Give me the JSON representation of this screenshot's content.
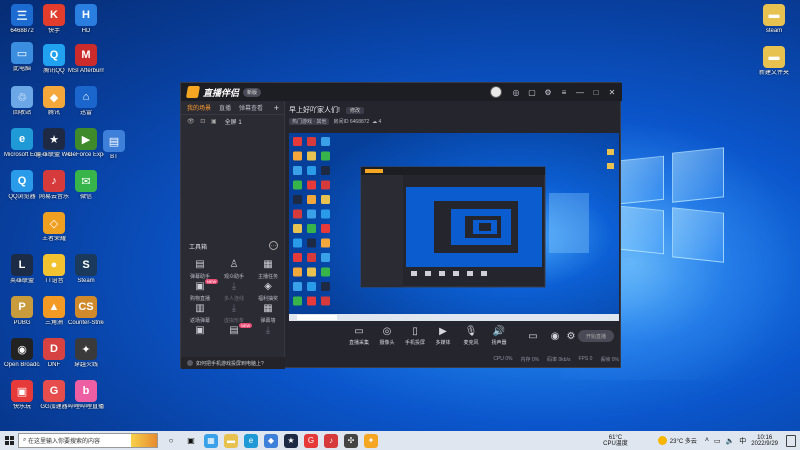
{
  "desktop_icons": [
    {
      "label": "6468872",
      "color": "#1c6bd0",
      "glyph": "三",
      "icon": "monitor-icon"
    },
    {
      "label": "此电脑",
      "color": "#3b8de0",
      "glyph": "▭",
      "icon": "computer-icon"
    },
    {
      "label": "回收站",
      "color": "#6ba6e6",
      "glyph": "♲",
      "icon": "recycle-bin-icon"
    },
    {
      "label": "Microsoft Edge",
      "color": "#1f9ad6",
      "glyph": "e",
      "icon": "edge-icon"
    },
    {
      "label": "QQ浏览器",
      "color": "#2a9be8",
      "glyph": "Q",
      "icon": "qq-browser-icon"
    },
    {
      "label": "腾讯",
      "color": "#f4a73a",
      "glyph": "◆",
      "icon": "tencent-icon"
    },
    {
      "label": "BT",
      "color": "#3d7fd9",
      "glyph": "▤",
      "icon": "bt-icon"
    },
    {
      "label": "TT语音",
      "color": "#f2c230",
      "glyph": "●",
      "icon": "voice-icon"
    },
    {
      "label": "Open Broadcaster",
      "color": "#222222",
      "glyph": "◉",
      "icon": "obs-icon"
    },
    {
      "label": "快乐玩",
      "color": "#e63a3a",
      "glyph": "▣",
      "icon": "game-icon"
    },
    {
      "label": "英雄联盟 WeGame版",
      "color": "#1e2a44",
      "glyph": "★",
      "icon": "wegame-icon"
    },
    {
      "label": "HD",
      "color": "#2a7ee0",
      "glyph": "H",
      "icon": "hd-icon"
    },
    {
      "label": "网易云音乐",
      "color": "#d63a3a",
      "glyph": "♪",
      "icon": "music-icon"
    },
    {
      "label": "王者荣耀",
      "color": "#f0a020",
      "glyph": "◇",
      "icon": "honor-icon"
    },
    {
      "label": "三角洲",
      "color": "#f39a24",
      "glyph": "▲",
      "icon": "delta-icon"
    },
    {
      "label": "迅雷",
      "color": "#1a66cc",
      "glyph": "⌂",
      "icon": "thunder-icon"
    },
    {
      "label": "MSI Afterburner",
      "color": "#cc2b2b",
      "glyph": "M",
      "icon": "msi-icon"
    },
    {
      "label": "GG加速器",
      "color": "#e84d4d",
      "glyph": "G",
      "icon": "accelerator-icon"
    },
    {
      "label": "哔哩哔哩直播",
      "color": "#ee5ea2",
      "glyph": "b",
      "icon": "bilibili-icon"
    },
    {
      "label": "微信",
      "color": "#38b54a",
      "glyph": "✉",
      "icon": "wechat-icon"
    },
    {
      "label": "GeForce Experience",
      "color": "#3f8a2b",
      "glyph": "▶",
      "icon": "geforce-icon"
    },
    {
      "label": "Steam",
      "color": "#1b3a5b",
      "glyph": "S",
      "icon": "steam-icon"
    },
    {
      "label": "Counter-Strike",
      "color": "#d08a2b",
      "glyph": "CS",
      "icon": "cs-icon"
    },
    {
      "label": "穿越火线",
      "color": "#3a3a3a",
      "glyph": "✦",
      "icon": "cf-icon"
    },
    {
      "label": "快手",
      "color": "#e23c2c",
      "glyph": "K",
      "icon": "kuaishou-icon"
    },
    {
      "label": "腾讯QQ",
      "color": "#20a2f0",
      "glyph": "Q",
      "icon": "qq-icon"
    },
    {
      "label": "PUBG",
      "color": "#c89b3c",
      "glyph": "P",
      "icon": "pubg-icon"
    },
    {
      "label": "DNF",
      "color": "#d64242",
      "glyph": "D",
      "icon": "dnf-icon"
    },
    {
      "label": "英雄联盟",
      "color": "#1c2c46",
      "glyph": "L",
      "icon": "lol-icon"
    },
    {
      "label": "新建文件夹",
      "color": "#e7c250",
      "glyph": "▬",
      "icon": "folder-icon"
    },
    {
      "label": "steam",
      "color": "#e7c250",
      "glyph": "▬",
      "icon": "folder-icon"
    }
  ],
  "app": {
    "logo_text": "直播伴侣",
    "version_badge": "新版",
    "left_tabs": [
      "我的场景",
      "直播",
      "弹幕查看"
    ],
    "active_tab": 0,
    "scene_name": "全屏 1",
    "room_title": "早上好吖家人们!",
    "room_edit": "修改",
    "room_category": "热门游戏 · 其他",
    "room_id_label": "房间ID",
    "room_id": "6468872",
    "room_online": "4",
    "tools_title": "工具箱",
    "tools": [
      {
        "label": "弹幕助手",
        "icon": "barrage-icon",
        "dim": false
      },
      {
        "label": "观众助手",
        "icon": "viewer-icon",
        "dim": false
      },
      {
        "label": "主播任务",
        "icon": "task-icon",
        "dim": false
      },
      {
        "label": "购物直播",
        "icon": "shop-icon",
        "dim": false,
        "tag": "NEW"
      },
      {
        "label": "多人连线",
        "icon": "multi-link-icon",
        "dim": true
      },
      {
        "label": "福利抽奖",
        "icon": "lottery-icon",
        "dim": false
      },
      {
        "label": "返场弹幕",
        "icon": "replay-icon",
        "dim": false
      },
      {
        "label": "虚拟形象",
        "icon": "avatar-icon",
        "dim": true
      },
      {
        "label": "弹幕墙",
        "icon": "wall-icon",
        "dim": false
      },
      {
        "label": "",
        "icon": "camera-tool-icon",
        "dim": false
      },
      {
        "label": "",
        "icon": "live-tool-icon",
        "dim": false,
        "tag": "NEW"
      },
      {
        "label": "",
        "icon": "download-tool-icon",
        "dim": true
      }
    ],
    "footer_text": "如何把手机游戏投屏到电脑上?",
    "bottom_buttons": [
      {
        "label": "直播采集",
        "icon": "capture-icon"
      },
      {
        "label": "摄像头",
        "icon": "camera-icon"
      },
      {
        "label": "手机投屏",
        "icon": "phone-cast-icon"
      },
      {
        "label": "多媒体",
        "icon": "media-icon"
      },
      {
        "label": "麦克风",
        "icon": "mic-icon"
      },
      {
        "label": "扬声器",
        "icon": "speaker-icon"
      }
    ],
    "start_live": "开始直播",
    "status": [
      "CPU 0%",
      "内存 0%",
      "码率 0kb/s",
      "FPS 0",
      "丢帧 0%"
    ]
  },
  "taskbar": {
    "search_placeholder": "在这里输入你要搜索的内容",
    "temperature": "61°C",
    "temp_label": "CPU温度",
    "weather": "23°C 多云",
    "ime": "中",
    "time": "10:16",
    "date": "2022/9/29"
  },
  "colors": {
    "accent": "#ff9d2e",
    "app_bg": "#25252d",
    "desktop_blue": "#0b56cc"
  }
}
